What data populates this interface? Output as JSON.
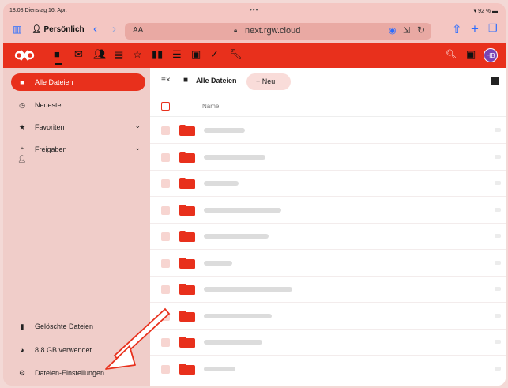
{
  "status_bar": {
    "time": "18:08  Dienstag 16. Apr.",
    "battery": "92 %"
  },
  "safari": {
    "profile_label": "Persönlich",
    "text_size_label": "AA",
    "url": "next.rgw.cloud"
  },
  "header": {
    "avatar_initials": "HB"
  },
  "sidebar": {
    "items": [
      {
        "label": "Alle Dateien"
      },
      {
        "label": "Neueste"
      },
      {
        "label": "Favoriten"
      },
      {
        "label": "Freigaben"
      }
    ],
    "footer": {
      "deleted_label": "Gelöschte Dateien",
      "usage_label": "8,8 GB verwendet",
      "settings_label": "Dateien-Einstellungen"
    }
  },
  "main": {
    "breadcrumb": "Alle Dateien",
    "new_button": "+  Neu",
    "column_name": "Name",
    "row_count": 10
  },
  "colors": {
    "accent": "#e8301c",
    "sidebar_bg": "#f0cdc9",
    "annotation_arrow": "#e8301c"
  }
}
